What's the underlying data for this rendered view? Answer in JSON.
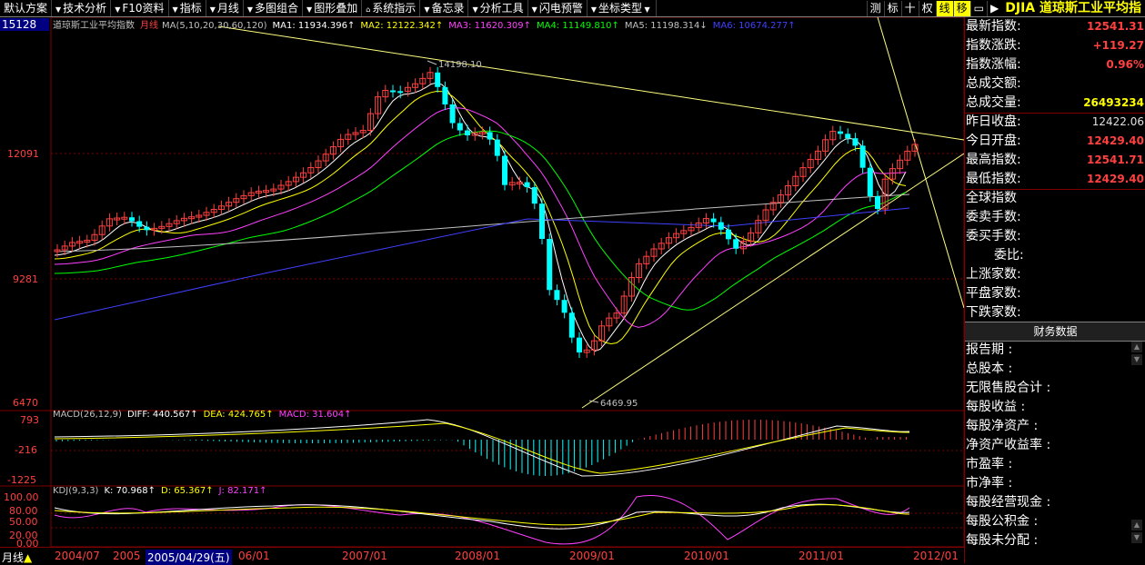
{
  "toolbar": {
    "items": [
      "默认方案",
      "技术分析",
      "F10资料",
      "指标",
      "月线",
      "多图组合",
      "图形叠加",
      "系统指示",
      "备忘录",
      "分析工具",
      "闪电预警",
      "坐标类型"
    ],
    "right_buttons": [
      "测",
      "标",
      "十",
      "权",
      "线",
      "移"
    ],
    "index_title": "DJIA 道琼斯工业平均指"
  },
  "chart": {
    "code": "15128",
    "main_label": "道琼斯工业平均指数",
    "period_word": "月线",
    "ma_params": "MA(5,10,20,30,60,120)",
    "ma1": "MA1: 11934.396↑",
    "ma2": "MA2: 12122.342↑",
    "ma3": "MA3: 11620.309↑",
    "ma4": "MA4: 11149.810↑",
    "ma5": "MA5: 11198.314↓",
    "ma6": "MA6: 10674.277↑",
    "high_annot": "14198.10",
    "low_annot": "6469.95",
    "y_labels": [
      "12091",
      "9281",
      "6470"
    ],
    "macd_label": "MACD(26,12,9)",
    "macd_diff": "DIFF: 440.567↑",
    "macd_dea": "DEA: 424.765↑",
    "macd_val": "MACD: 31.604↑",
    "macd_y": [
      "793",
      "-216",
      "-1225"
    ],
    "kdj_label": "KDJ(9,3,3)",
    "kdj_k": "K: 70.968↑",
    "kdj_d": "D: 65.367↑",
    "kdj_j": "J: 82.171↑",
    "kdj_y": [
      "100.00",
      "80.00",
      "50.00",
      "20.00",
      "0.00"
    ]
  },
  "xaxis": {
    "period": "月线",
    "labels": [
      "2004/07",
      "2005",
      "2005/04/29(五)",
      "06/01",
      "2007/01",
      "2008/01",
      "2009/01",
      "2010/01",
      "2011/01",
      "2012/01"
    ]
  },
  "side": {
    "rows": [
      {
        "label": "最新指数:",
        "value": "12541.31",
        "style": "red"
      },
      {
        "label": "指数涨跌:",
        "value": "+119.27",
        "style": "red"
      },
      {
        "label": "指数涨幅:",
        "value": "0.96%",
        "style": "red"
      },
      {
        "label": "总成交额:",
        "value": "",
        "style": "red"
      },
      {
        "label": "总成交量:",
        "value": "26493234",
        "style": "yellow"
      },
      {
        "label": "昨日收盘:",
        "value": "12422.06",
        "style": "white"
      },
      {
        "label": "今日开盘:",
        "value": "12429.40",
        "style": "red"
      },
      {
        "label": "最高指数:",
        "value": "12541.71",
        "style": "red"
      },
      {
        "label": "最低指数:",
        "value": "12429.40",
        "style": "red"
      },
      {
        "label": "全球指数",
        "value": "",
        "style": "red"
      },
      {
        "label": "委卖手数:",
        "value": "",
        "style": "red"
      },
      {
        "label": "委买手数:",
        "value": "",
        "style": "red"
      },
      {
        "label": "委比:",
        "value": "",
        "style": "red"
      },
      {
        "label": "上涨家数:",
        "value": "",
        "style": "red"
      },
      {
        "label": "平盘家数:",
        "value": "",
        "style": "red"
      },
      {
        "label": "下跌家数:",
        "value": "",
        "style": "red"
      }
    ],
    "fin_title": "财务数据",
    "fin_rows": [
      "报告期 :",
      "总股本 :",
      "无限售股合计 :",
      "每股收益 :",
      "每股净资产 :",
      "净资产收益率 :",
      "市盈率 :",
      "市净率 :",
      "每股经营现金 :",
      "每股公积金 :",
      "每股未分配 :"
    ]
  },
  "colors": {
    "up": "#ff4040",
    "down": "#00ffff",
    "ma1": "#ffffff",
    "ma2": "#ffff00",
    "ma3": "#ff40ff",
    "ma4": "#00ff00",
    "ma5": "#c0c0c0",
    "ma6": "#4040ff"
  }
}
